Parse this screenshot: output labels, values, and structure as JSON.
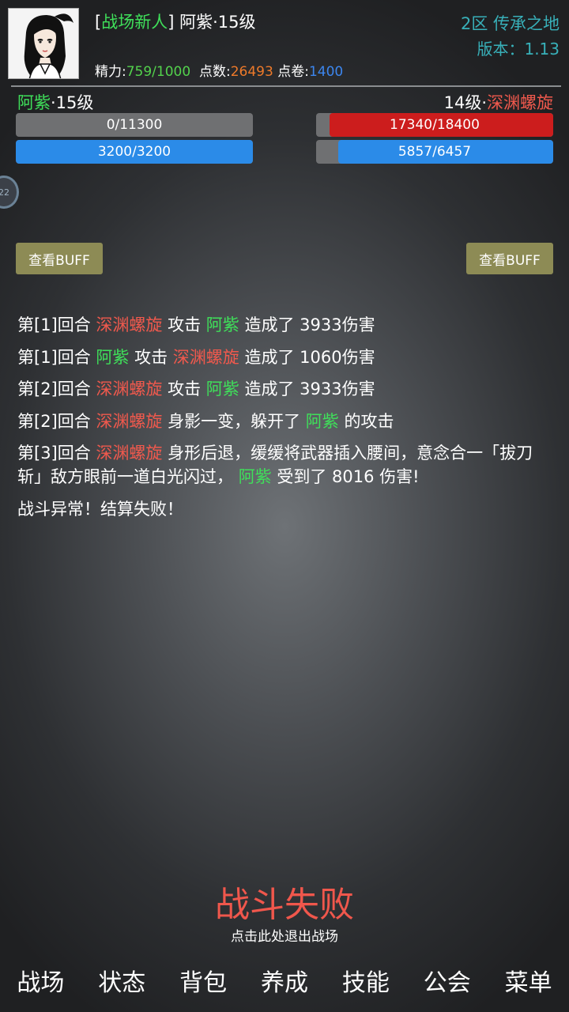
{
  "header": {
    "title_prefix": "[",
    "title_tag": "战场新人",
    "title_suffix": "] 阿紫·15级",
    "stats": {
      "energy_label": "精力:",
      "energy_value": "759/1000",
      "points_label": "点数:",
      "points_value": "26493",
      "vouchers_label": "点卷:",
      "vouchers_value": "1400"
    },
    "server": "2区 传承之地",
    "version": "版本：1.13"
  },
  "player": {
    "name": "阿紫",
    "level_text": "·15级",
    "hp_text": "0/11300",
    "hp_fraction": 0.0,
    "mp_text": "3200/3200",
    "mp_fraction": 1.0
  },
  "enemy": {
    "level_text": "14级·",
    "name": "深渊螺旋",
    "hp_text": "17340/18400",
    "hp_fraction": 0.942,
    "mp_text": "5857/6457",
    "mp_fraction": 0.907
  },
  "side_bubble": "22",
  "buttons": {
    "view_buff_left": "查看BUFF",
    "view_buff_right": "查看BUFF"
  },
  "log": {
    "l1": [
      "第[1]回合 ",
      "深渊螺旋",
      " 攻击 ",
      "阿紫",
      " 造成了 3933伤害"
    ],
    "l2": [
      "第[1]回合 ",
      "阿紫",
      " 攻击 ",
      "深渊螺旋",
      " 造成了 1060伤害"
    ],
    "l3": [
      "第[2]回合 ",
      "深渊螺旋",
      " 攻击 ",
      "阿紫",
      " 造成了 3933伤害"
    ],
    "l4": [
      "第[2]回合 ",
      "深渊螺旋",
      " 身影一变，躲开了 ",
      "阿紫",
      " 的攻击"
    ],
    "l5": [
      "第[3]回合 ",
      "深渊螺旋",
      " 身形后退，缓缓将武器插入腰间，意念合一「拔刀斩」敌方眼前一道白光闪过， ",
      "阿紫",
      " 受到了 8016 伤害!"
    ],
    "l6": "战斗异常！结算失败！"
  },
  "result": {
    "title": "战斗失败",
    "hint": "点击此处退出战场"
  },
  "nav": [
    "战场",
    "状态",
    "背包",
    "养成",
    "技能",
    "公会",
    "菜单"
  ],
  "colors": {
    "player_name": "#3fe05a",
    "enemy_name": "#f0594d",
    "hp_fill": "#cc1d1d",
    "mp_fill": "#2b8be8",
    "buff_button": "#8d8b55",
    "result_red": "#f0574c"
  }
}
